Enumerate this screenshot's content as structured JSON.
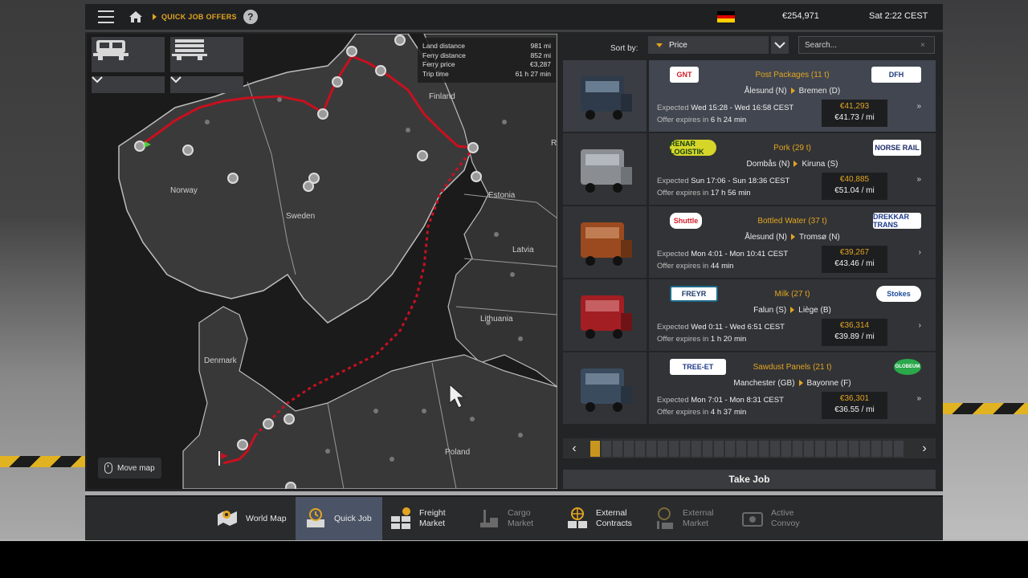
{
  "topbar": {
    "breadcrumb": "QUICK JOB OFFERS",
    "help": "?",
    "money": "€254,971",
    "time": "Sat 2:22 CEST",
    "flag_colors": [
      "#000000",
      "#dd0000",
      "#ffce00"
    ]
  },
  "map": {
    "labels": {
      "norway": "Norway",
      "sweden": "Sweden",
      "finland": "Finland",
      "estonia": "Estonia",
      "latvia": "Latvia",
      "lithuania": "Lithuania",
      "denmark": "Denmark",
      "poland": "Poland",
      "russia": "Ru"
    },
    "route_info": {
      "land_distance_label": "Land distance",
      "land_distance": "981 mi",
      "ferry_distance_label": "Ferry distance",
      "ferry_distance": "852 mi",
      "ferry_price_label": "Ferry price",
      "ferry_price": "€3,287",
      "trip_time_label": "Trip time",
      "trip_time": "61 h 27 min"
    },
    "move_map": "Move map"
  },
  "sort": {
    "label": "Sort by:",
    "value": "Price",
    "search_placeholder": "Search...",
    "clear": "×"
  },
  "jobs": [
    {
      "src_company": "GNT",
      "dst_company": "DFH",
      "cargo": "Post Packages (11 t)",
      "from": "Ålesund (N)",
      "to": "Bremen (D)",
      "expected_label": "Expected",
      "expected": "Wed 15:28 - Wed 16:58 CEST",
      "expires_label": "Offer expires in",
      "expires": "6 h 24 min",
      "price": "€41,293",
      "per_mile": "€41.73 / mi",
      "icons": "»",
      "truck_color": "#2f3b4a"
    },
    {
      "src_company": "RENAR LOGISTIK",
      "dst_company": "NORSE RAIL",
      "cargo": "Pork (29 t)",
      "from": "Dombås (N)",
      "to": "Kiruna (S)",
      "expected_label": "Expected",
      "expected": "Sun 17:06 - Sun 18:36 CEST",
      "expires_label": "Offer expires in",
      "expires": "17 h 56 min",
      "price": "€40,885",
      "per_mile": "€51.04 / mi",
      "icons": "»",
      "truck_color": "#8a8d92"
    },
    {
      "src_company": "Shuttle",
      "dst_company": "DREKKAR TRANS",
      "cargo": "Bottled Water (37 t)",
      "from": "Ålesund (N)",
      "to": "Tromsø (N)",
      "expected_label": "Expected",
      "expected": "Mon 4:01 - Mon 10:41 CEST",
      "expires_label": "Offer expires in",
      "expires": "44 min",
      "price": "€39,267",
      "per_mile": "€43.46 / mi",
      "icons": "›",
      "truck_color": "#9a4a1e"
    },
    {
      "src_company": "FREYR",
      "dst_company": "Stokes",
      "cargo": "Milk (27 t)",
      "from": "Falun (S)",
      "to": "Liège (B)",
      "expected_label": "Expected",
      "expected": "Wed 0:11 - Wed 6:51 CEST",
      "expires_label": "Offer expires in",
      "expires": "1 h 20 min",
      "price": "€36,314",
      "per_mile": "€39.89 / mi",
      "icons": "›",
      "truck_color": "#a31e22"
    },
    {
      "src_company": "TREE-ET",
      "dst_company": "GLOBEUM",
      "cargo": "Sawdust Panels (21 t)",
      "from": "Manchester (GB)",
      "to": "Bayonne (F)",
      "expected_label": "Expected",
      "expected": "Mon 7:01 - Mon 8:31 CEST",
      "expires_label": "Offer expires in",
      "expires": "4 h 37 min",
      "price": "€36,301",
      "per_mile": "€36.55 / mi",
      "icons": "»",
      "truck_color": "#3a4b5e"
    }
  ],
  "pager": {
    "prev": "‹",
    "next": "›"
  },
  "take_job": "Take Job",
  "nav": {
    "world_map": "World Map",
    "quick_job": "Quick Job",
    "freight_market_1": "Freight",
    "freight_market_2": "Market",
    "cargo_market_1": "Cargo",
    "cargo_market_2": "Market",
    "external_contracts_1": "External",
    "external_contracts_2": "Contracts",
    "external_market_1": "External",
    "external_market_2": "Market",
    "active_convoy_1": "Active",
    "active_convoy_2": "Convoy"
  },
  "colors": {
    "accent": "#e2a521",
    "route": "#c8101e",
    "active_nav": "#4b5466"
  }
}
